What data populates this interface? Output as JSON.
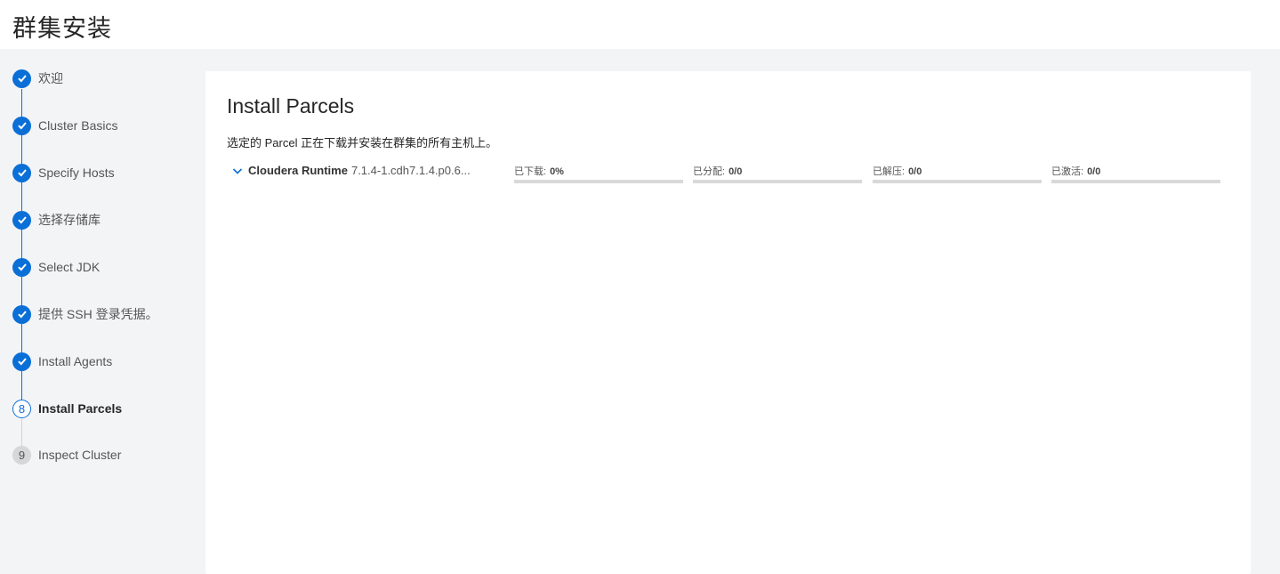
{
  "header": {
    "title": "群集安装"
  },
  "steps": [
    {
      "label": "欢迎",
      "state": "done",
      "num": ""
    },
    {
      "label": "Cluster Basics",
      "state": "done",
      "num": ""
    },
    {
      "label": "Specify Hosts",
      "state": "done",
      "num": ""
    },
    {
      "label": "选择存储库",
      "state": "done",
      "num": ""
    },
    {
      "label": "Select JDK",
      "state": "done",
      "num": ""
    },
    {
      "label": "提供 SSH 登录凭据。",
      "state": "done",
      "num": ""
    },
    {
      "label": "Install Agents",
      "state": "done",
      "num": ""
    },
    {
      "label": "Install Parcels",
      "state": "current",
      "num": "8"
    },
    {
      "label": "Inspect Cluster",
      "state": "todo",
      "num": "9"
    }
  ],
  "main": {
    "title": "Install Parcels",
    "description": "选定的 Parcel 正在下载并安装在群集的所有主机上。",
    "parcel": {
      "name": "Cloudera Runtime",
      "version": "7.1.4-1.cdh7.1.4.p0.6..."
    },
    "stats": [
      {
        "label": "已下载:",
        "value": "0%",
        "progress": 0
      },
      {
        "label": "已分配:",
        "value": "0/0",
        "progress": 0
      },
      {
        "label": "已解压:",
        "value": "0/0",
        "progress": 0
      },
      {
        "label": "已激活:",
        "value": "0/0",
        "progress": 0
      }
    ]
  },
  "colors": {
    "accent": "#0a6fd6",
    "track": "#d9d9d9"
  }
}
